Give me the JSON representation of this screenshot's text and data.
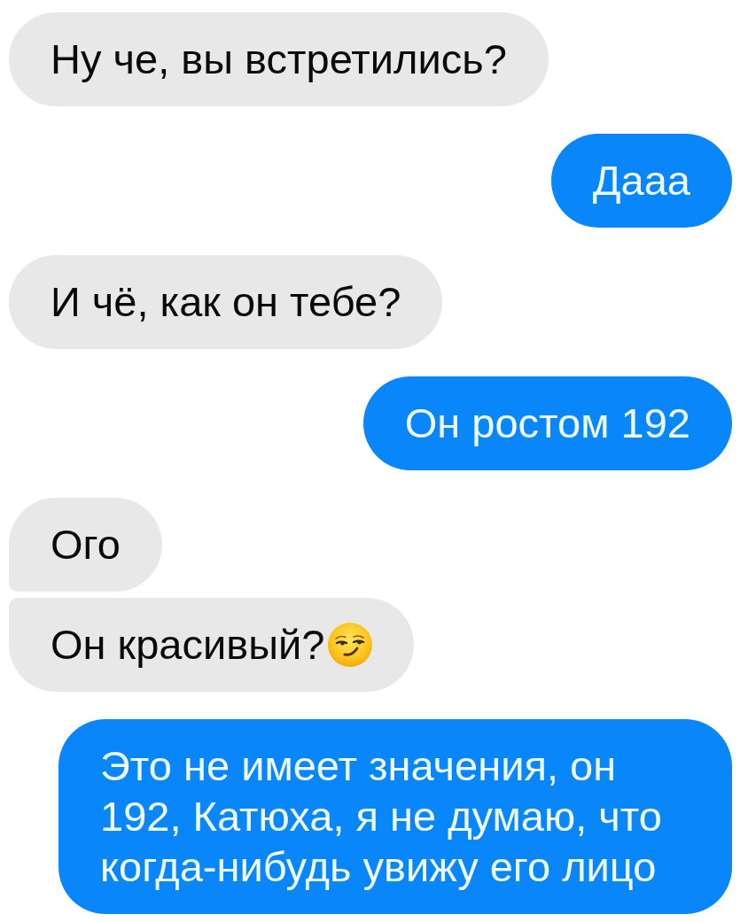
{
  "messages": [
    {
      "kind": "incoming",
      "text": "Ну че, вы встретились?",
      "emoji": false
    },
    {
      "kind": "outgoing",
      "text": "Дааа",
      "emoji": false
    },
    {
      "kind": "incoming",
      "text": "И чё, как он тебе?",
      "emoji": false
    },
    {
      "kind": "outgoing",
      "text": "Он ростом 192",
      "emoji": false
    },
    {
      "kind": "incoming",
      "text": "Ого",
      "emoji": false
    },
    {
      "kind": "incoming",
      "text": "Он красивый?",
      "emoji": true
    },
    {
      "kind": "outgoing",
      "text": "Это не имеет значения, он 192, Катюха, я не думаю, что когда-нибудь увижу его лицо",
      "emoji": false
    }
  ]
}
